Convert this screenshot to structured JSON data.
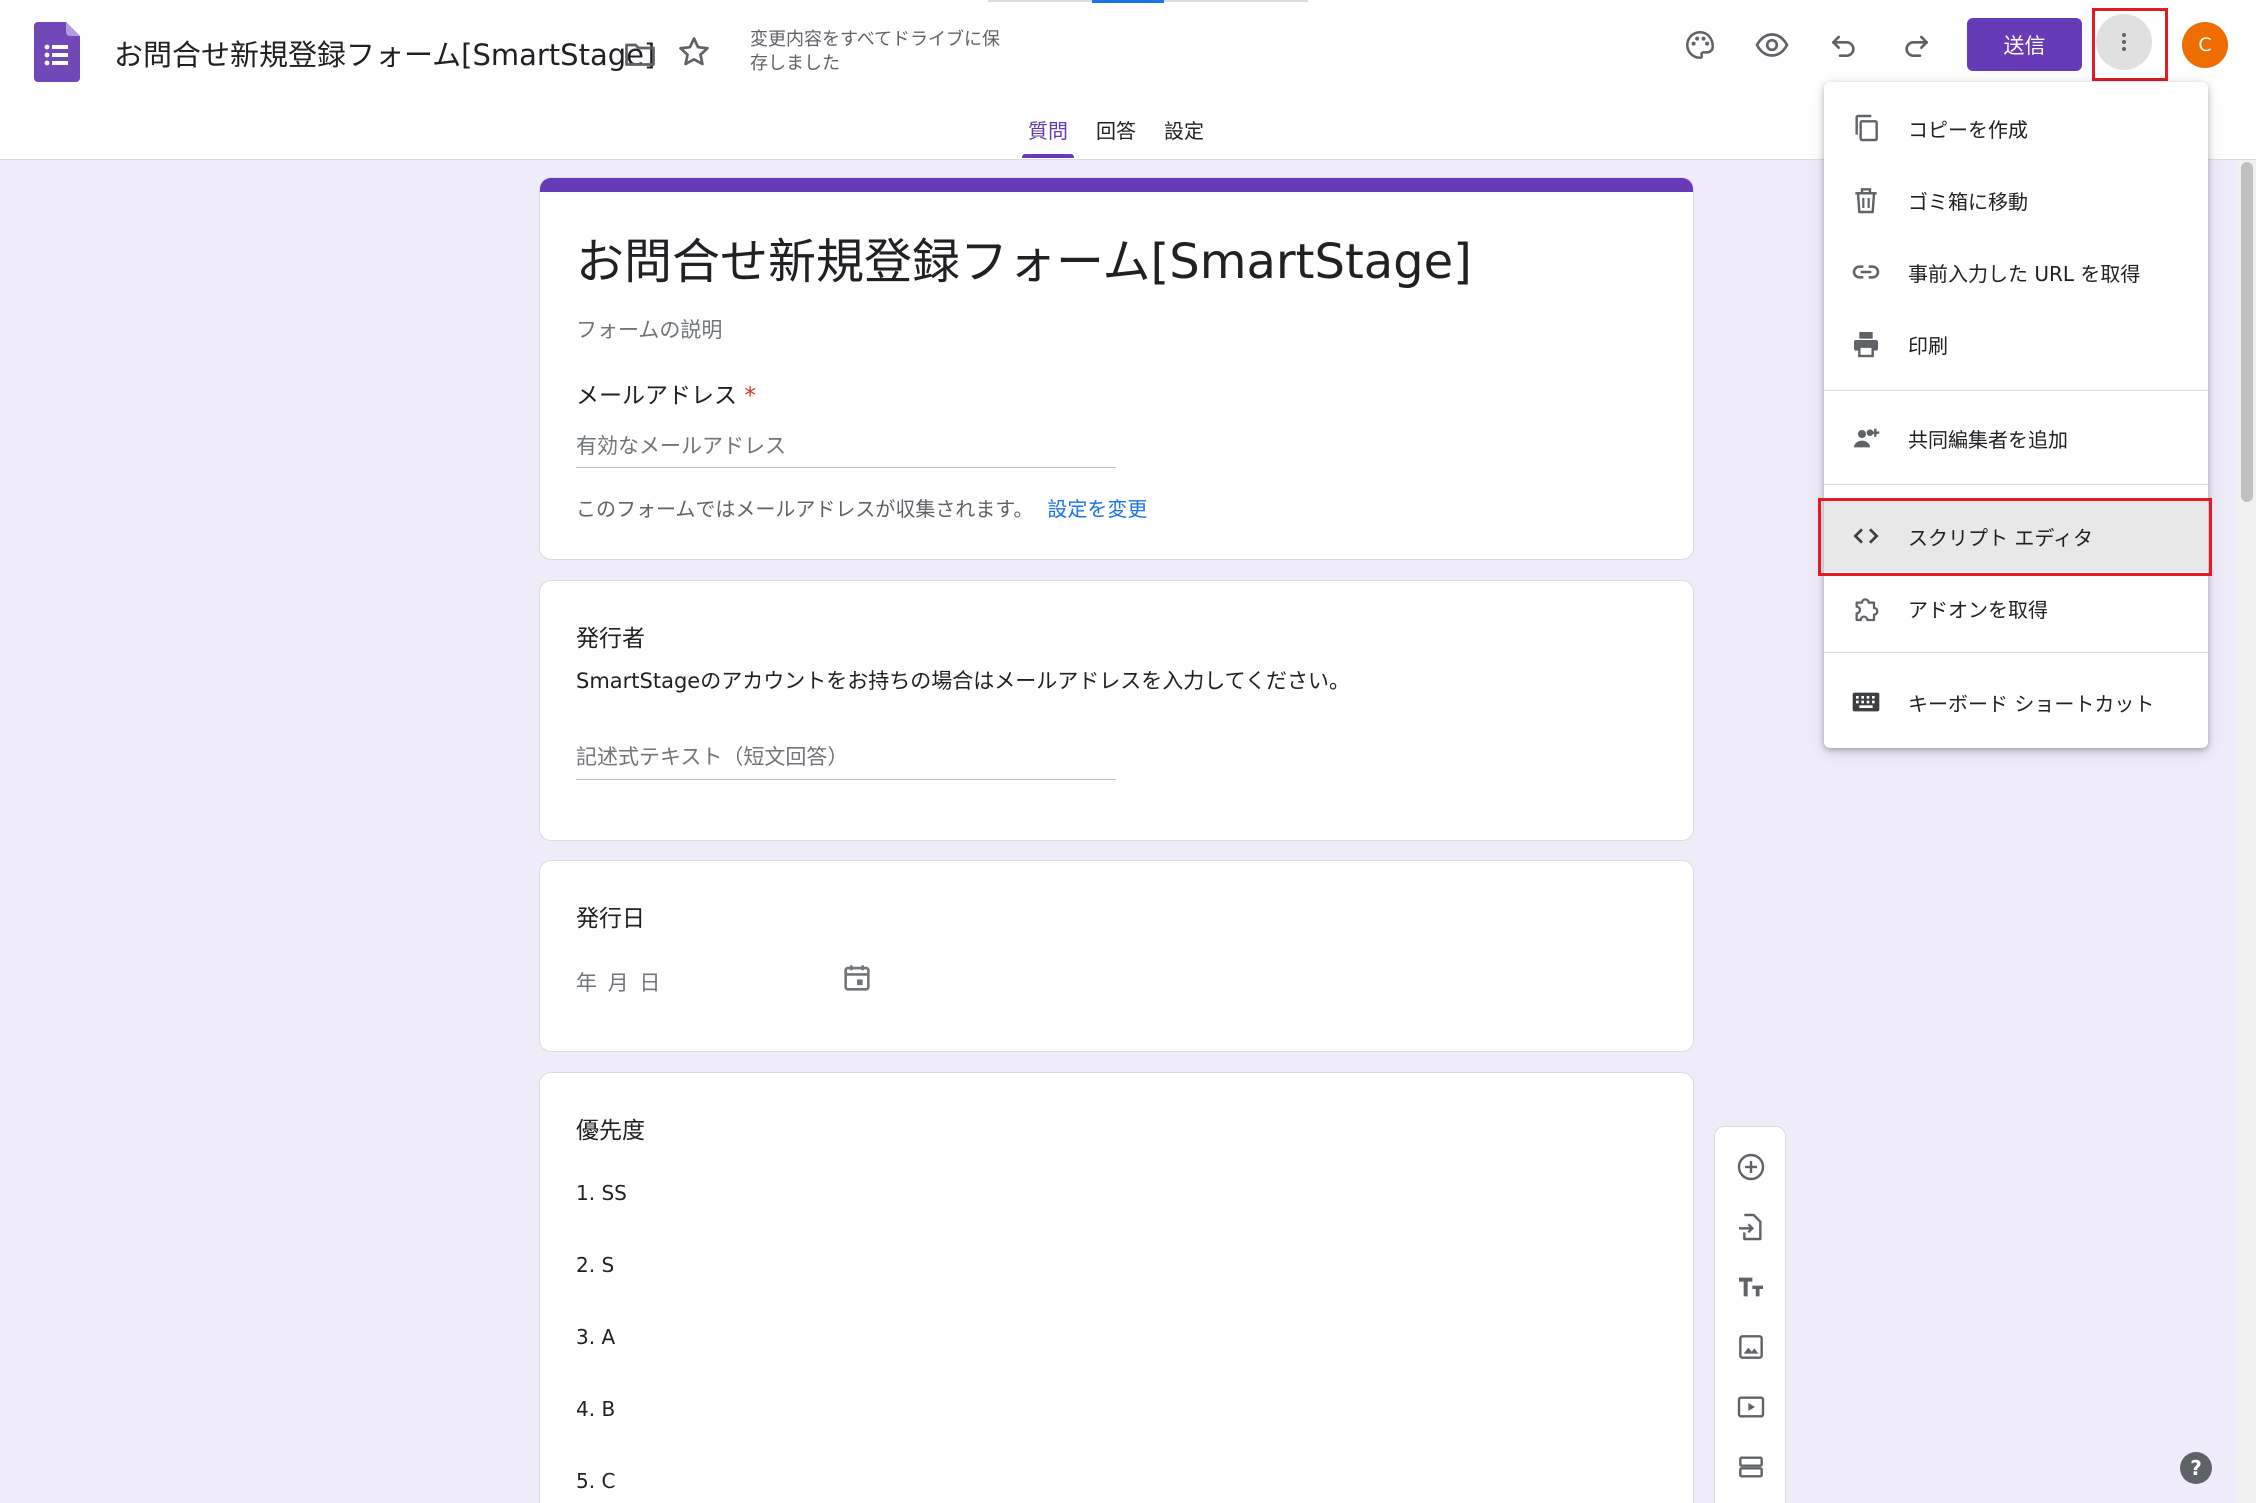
{
  "header": {
    "doc_title": "お問合せ新規登録フォーム[SmartStage]",
    "save_status": "変更内容をすべてドライブに保存しました",
    "send_label": "送信",
    "avatar_letter": "C",
    "brand_color": "#673ab7"
  },
  "tabs": [
    {
      "label": "質問",
      "active": true
    },
    {
      "label": "回答",
      "active": false
    },
    {
      "label": "設定",
      "active": false
    }
  ],
  "form": {
    "title": "お問合せ新規登録フォーム[SmartStage]",
    "description_placeholder": "フォームの説明",
    "email_question": "メールアドレス",
    "required_mark": "*",
    "email_placeholder": "有効なメールアドレス",
    "email_note": "このフォームではメールアドレスが収集されます。",
    "email_link": "設定を変更"
  },
  "questions": [
    {
      "label": "発行者",
      "description": "SmartStageのアカウントをお持ちの場合はメールアドレスを入力してください。",
      "placeholder": "記述式テキスト（短文回答）"
    },
    {
      "label": "発行日",
      "placeholder": "年 月 日"
    },
    {
      "label": "優先度",
      "options": [
        "1.  SS",
        "2.  S",
        "3.  A",
        "4.  B",
        "5.  C"
      ]
    }
  ],
  "menu": {
    "items": [
      {
        "label": "コピーを作成",
        "icon": "copy-icon"
      },
      {
        "label": "ゴミ箱に移動",
        "icon": "trash-icon"
      },
      {
        "label": "事前入力した URL を取得",
        "icon": "link-icon"
      },
      {
        "label": "印刷",
        "icon": "print-icon"
      },
      {
        "label": "共同編集者を追加",
        "icon": "add-people-icon"
      },
      {
        "label": "スクリプト エディタ",
        "icon": "code-icon"
      },
      {
        "label": "アドオンを取得",
        "icon": "puzzle-icon"
      },
      {
        "label": "キーボード ショートカット",
        "icon": "keyboard-icon"
      }
    ]
  },
  "colors": {
    "accent": "#673ab7",
    "highlight_border": "#e01b24",
    "link": "#1a73e8",
    "background": "#f0ebf8"
  }
}
